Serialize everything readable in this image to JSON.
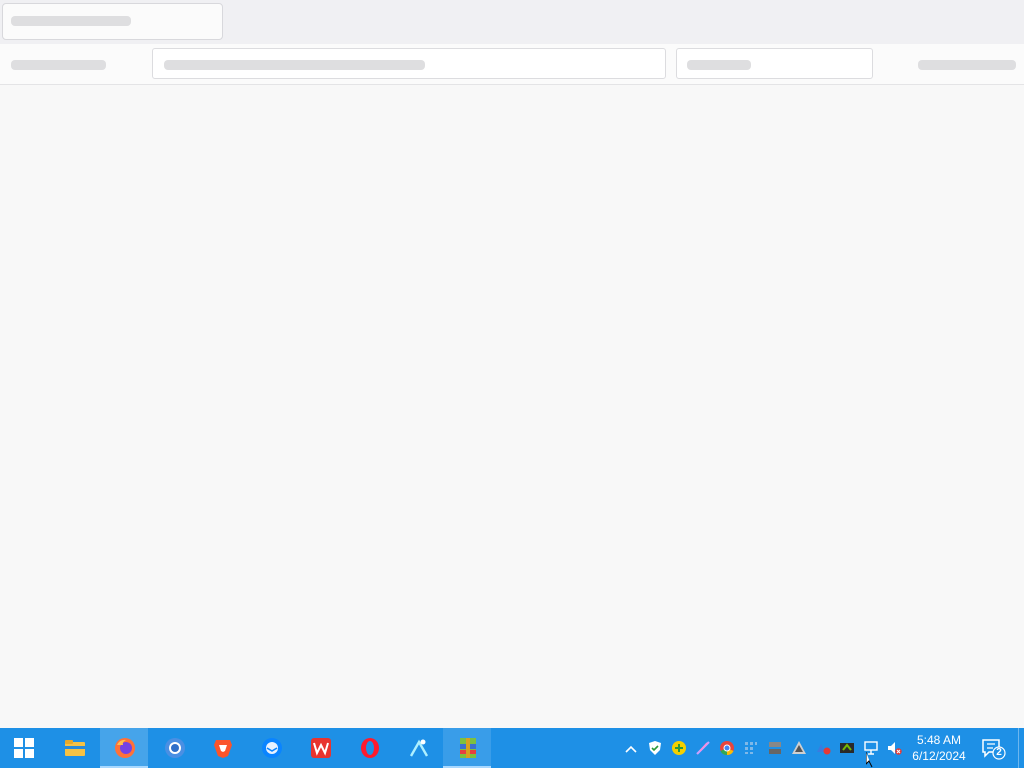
{
  "taskbar": {
    "apps": [
      {
        "name": "file-explorer"
      },
      {
        "name": "firefox"
      },
      {
        "name": "chromium"
      },
      {
        "name": "brave"
      },
      {
        "name": "thunderbird"
      },
      {
        "name": "wps-office"
      },
      {
        "name": "opera"
      },
      {
        "name": "app-launcher"
      },
      {
        "name": "winrar"
      }
    ],
    "clock": {
      "time": "5:48 AM",
      "date": "6/12/2024"
    },
    "notifications": {
      "count": "2"
    }
  },
  "colors": {
    "taskbar": "#1e90e6",
    "window_background": "#f8f8f8"
  }
}
